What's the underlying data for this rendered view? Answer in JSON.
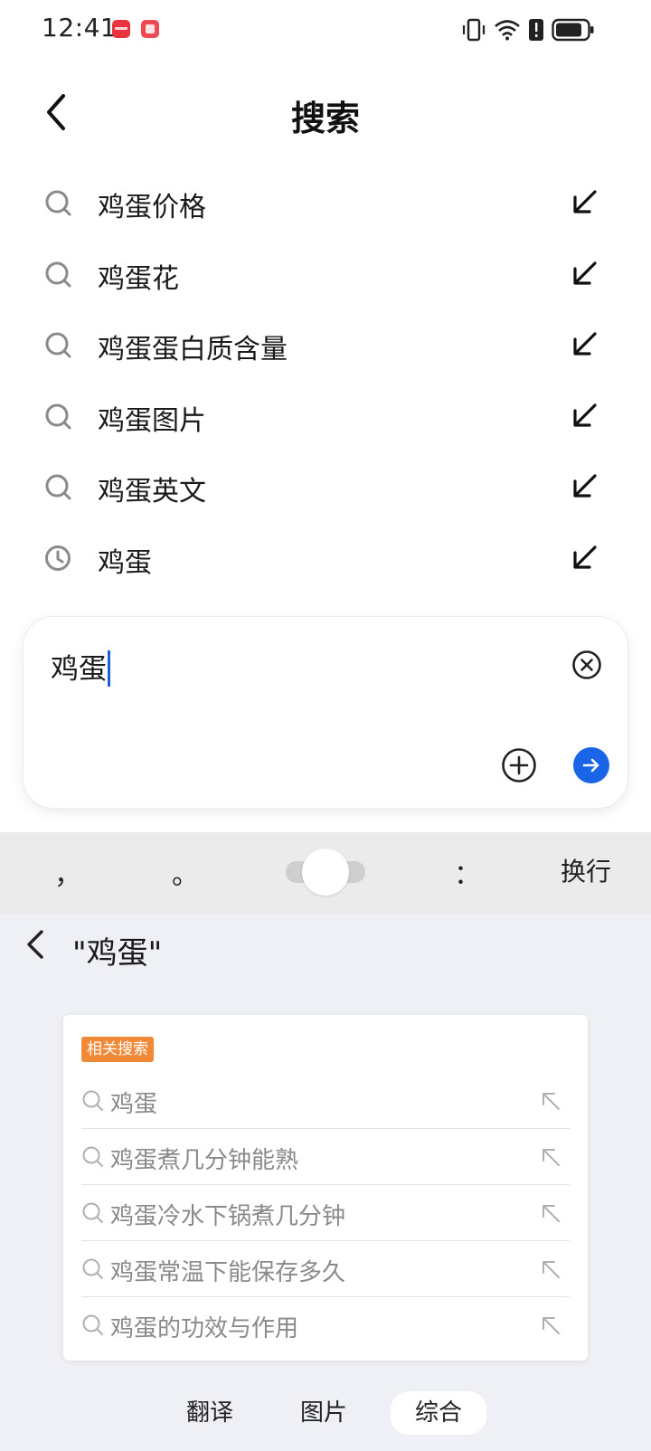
{
  "status_bar": {
    "time": "12:41"
  },
  "header": {
    "title": "搜索"
  },
  "suggestions": [
    {
      "text": "鸡蛋价格",
      "type": "search"
    },
    {
      "text": "鸡蛋花",
      "type": "search"
    },
    {
      "text": "鸡蛋蛋白质含量",
      "type": "search"
    },
    {
      "text": "鸡蛋图片",
      "type": "search"
    },
    {
      "text": "鸡蛋英文",
      "type": "search"
    },
    {
      "text": "鸡蛋",
      "type": "history"
    }
  ],
  "input": {
    "value": "鸡蛋"
  },
  "keyboard_toolbar": {
    "comma": "，",
    "period": "。",
    "colon": "：",
    "enter": "换行"
  },
  "query_panel": {
    "query": "\"鸡蛋\"",
    "related_tag": "相关搜索",
    "related": [
      "鸡蛋",
      "鸡蛋煮几分钟能熟",
      "鸡蛋冷水下锅煮几分钟",
      "鸡蛋常温下能保存多久",
      "鸡蛋的功效与作用"
    ]
  },
  "bottom_tabs": [
    "翻译",
    "图片",
    "综合"
  ],
  "colors": {
    "accent": "#1a64e8",
    "tag": "#f08a38",
    "battery": "#222222"
  },
  "icons": {
    "search": "search-icon",
    "history": "clock-icon",
    "fill": "arrow-up-left-fill-icon"
  }
}
